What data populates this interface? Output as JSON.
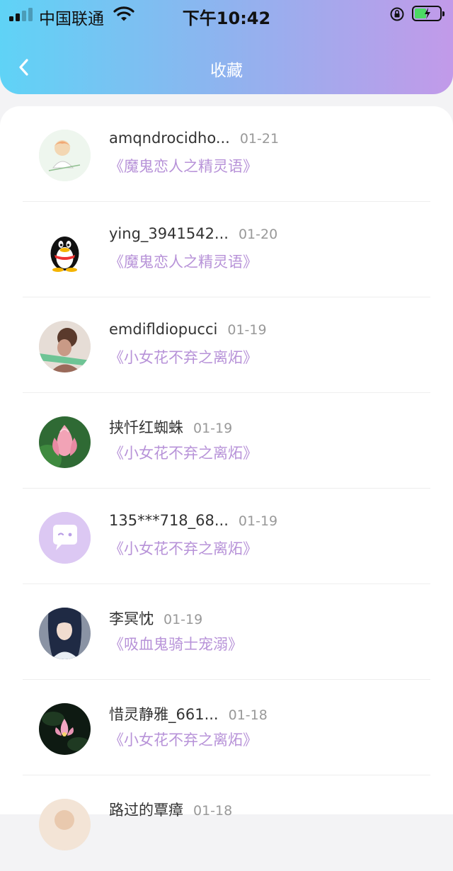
{
  "status_bar": {
    "carrier": "中国联通",
    "time": "下午10:42"
  },
  "header": {
    "title": "收藏"
  },
  "favorites": [
    {
      "user": "amqndrocidho...",
      "date": "01-21",
      "book": "《魔鬼恋人之精灵语》"
    },
    {
      "user": "ying_3941542...",
      "date": "01-20",
      "book": "《魔鬼恋人之精灵语》"
    },
    {
      "user": "emdifldiopucci",
      "date": "01-19",
      "book": "《小女花不弃之离炻》"
    },
    {
      "user": "挟忏红蜘蛛",
      "date": "01-19",
      "book": "《小女花不弃之离炻》"
    },
    {
      "user": "135***718_68...",
      "date": "01-19",
      "book": "《小女花不弃之离炻》"
    },
    {
      "user": "李冥忱",
      "date": "01-19",
      "book": "《吸血鬼骑士宠溺》"
    },
    {
      "user": "惜灵静雅_661...",
      "date": "01-18",
      "book": "《小女花不弃之离炻》"
    },
    {
      "user": "路过的覃瘴",
      "date": "01-18",
      "book": ""
    }
  ],
  "colors": {
    "header_start": "#5fd3f6",
    "header_end": "#c29ae9",
    "book_title": "#b792d8"
  }
}
